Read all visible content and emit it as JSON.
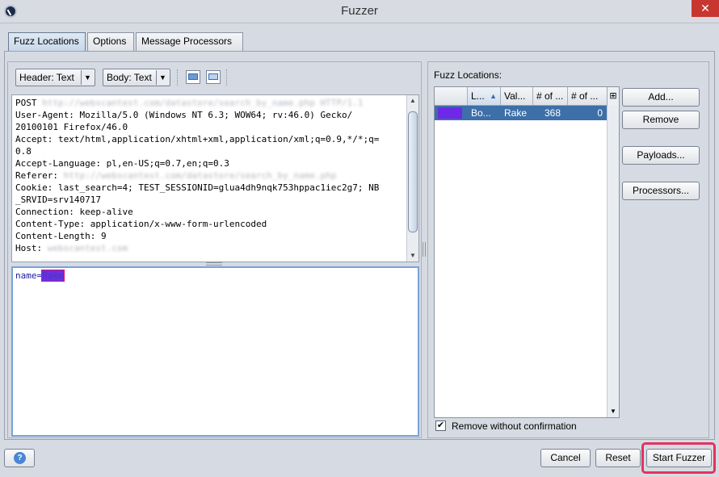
{
  "window": {
    "title": "Fuzzer",
    "close_glyph": "✕"
  },
  "tabs": [
    {
      "label": "Fuzz Locations",
      "active": true
    },
    {
      "label": "Options",
      "active": false
    },
    {
      "label": "Message Processors",
      "active": false
    }
  ],
  "request_editor": {
    "header_view_combo": "Header: Text",
    "body_view_combo": "Body: Text",
    "header_lines": [
      {
        "text": "POST ",
        "blurred": "http://webscantest.com/datastore/search_by_name.php HTTP/1.1"
      },
      {
        "text": "User-Agent: Mozilla/5.0 (Windows NT 6.3; WOW64; rv:46.0) Gecko/"
      },
      {
        "text": "20100101 Firefox/46.0"
      },
      {
        "text": "Accept: text/html,application/xhtml+xml,application/xml;q=0.9,*/*;q="
      },
      {
        "text": "0.8"
      },
      {
        "text": "Accept-Language: pl,en-US;q=0.7,en;q=0.3"
      },
      {
        "text": "Referer: ",
        "blurred": "http://webscantest.com/datastore/search_by_name.php"
      },
      {
        "text": "Cookie: last_search=4; TEST_SESSIONID=glua4dh9nqk753hppac1iec2g7; NB"
      },
      {
        "text": "_SRVID=srv140717"
      },
      {
        "text": "Connection: keep-alive"
      },
      {
        "text": "Content-Type: application/x-www-form-urlencoded"
      },
      {
        "text": "Content-Length: 9"
      },
      {
        "text": "Host: ",
        "blurred": "webscantest.com"
      }
    ],
    "body_key": "name=",
    "body_value": "Rake"
  },
  "fuzz_locations": {
    "label": "Fuzz Locations:",
    "columns": [
      "L...",
      "Val...",
      "# of ...",
      "# of ..."
    ],
    "rows": [
      {
        "location": "Bo...",
        "value": "Rake",
        "payloads": "368",
        "processors": "0",
        "color": "#6d28e8"
      }
    ],
    "buttons": {
      "add": "Add...",
      "remove": "Remove",
      "payloads": "Payloads...",
      "processors": "Processors..."
    },
    "remove_without_confirmation": {
      "label": "Remove without confirmation",
      "checked": true,
      "check_glyph": "✔"
    }
  },
  "footer": {
    "cancel": "Cancel",
    "reset": "Reset",
    "start": "Start Fuzzer",
    "help_glyph": "?"
  }
}
